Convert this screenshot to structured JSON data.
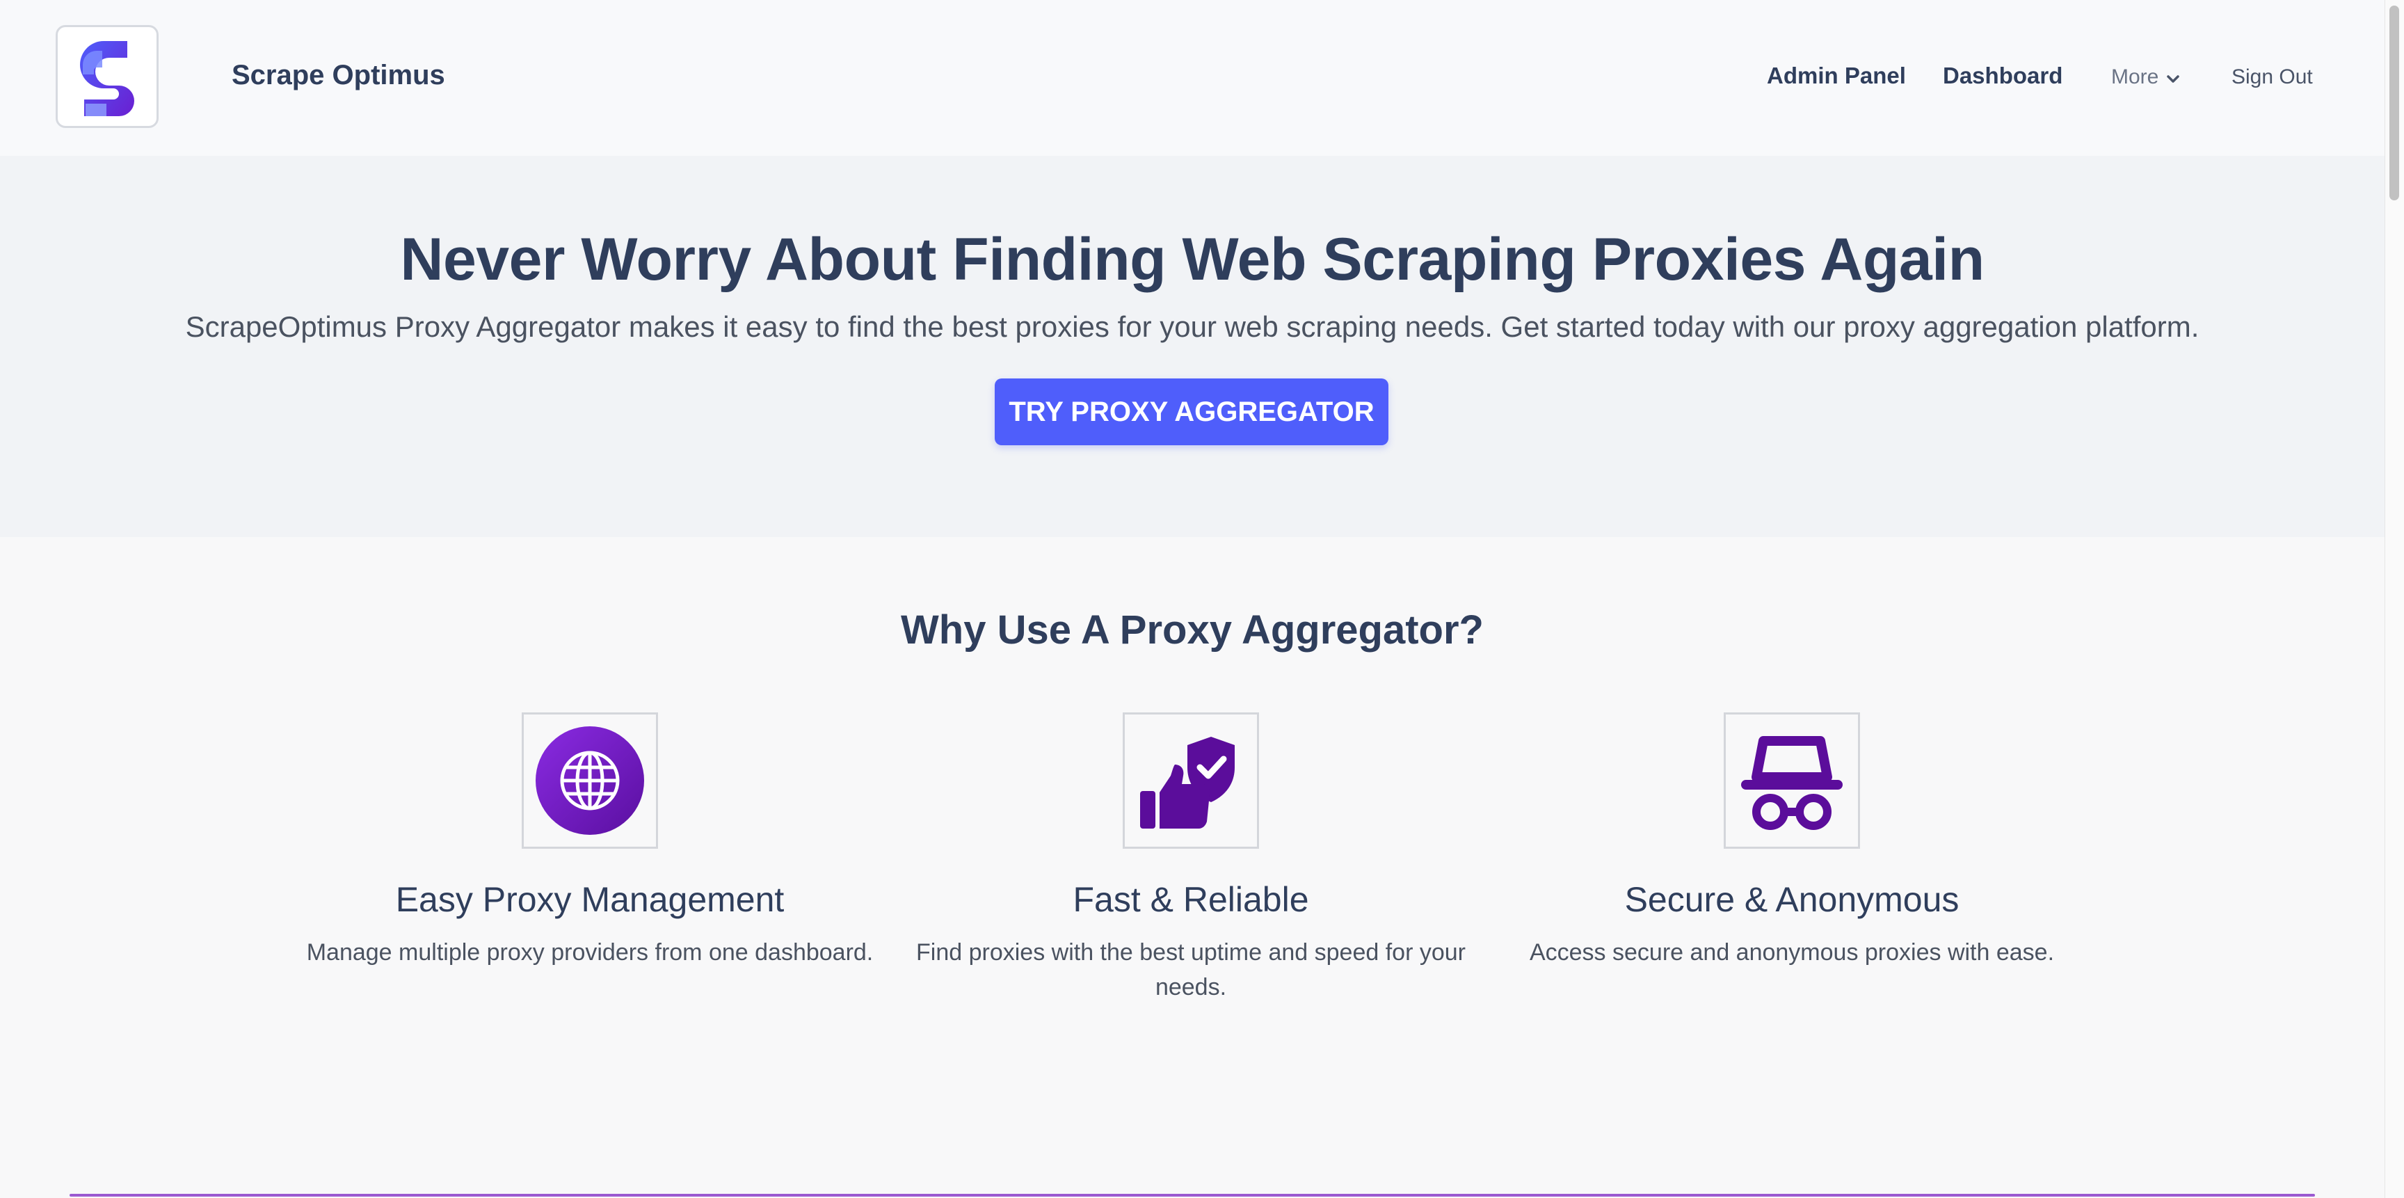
{
  "header": {
    "brand": "Scrape Optimus",
    "nav": {
      "admin_panel": "Admin Panel",
      "dashboard": "Dashboard",
      "more": "More",
      "sign_out": "Sign Out"
    }
  },
  "hero": {
    "title": "Never Worry About Finding Web Scraping Proxies Again",
    "subtitle": "ScrapeOptimus Proxy Aggregator makes it easy to find the best proxies for your web scraping needs. Get started today with our proxy aggregation platform.",
    "cta_label": "TRY PROXY AGGREGATOR"
  },
  "features": {
    "title": "Why Use A Proxy Aggregator?",
    "items": [
      {
        "icon": "globe-icon",
        "title": "Easy Proxy Management",
        "description": "Manage multiple proxy providers from one dashboard."
      },
      {
        "icon": "thumbs-up-shield-icon",
        "title": "Fast & Reliable",
        "description": "Find proxies with the best uptime and speed for your needs."
      },
      {
        "icon": "incognito-icon",
        "title": "Secure & Anonymous",
        "description": "Access secure and anonymous proxies with ease."
      }
    ]
  },
  "colors": {
    "accent": "#4f5efb",
    "heading": "#2f3e5c",
    "icon_purple": "#5b0d9b"
  }
}
